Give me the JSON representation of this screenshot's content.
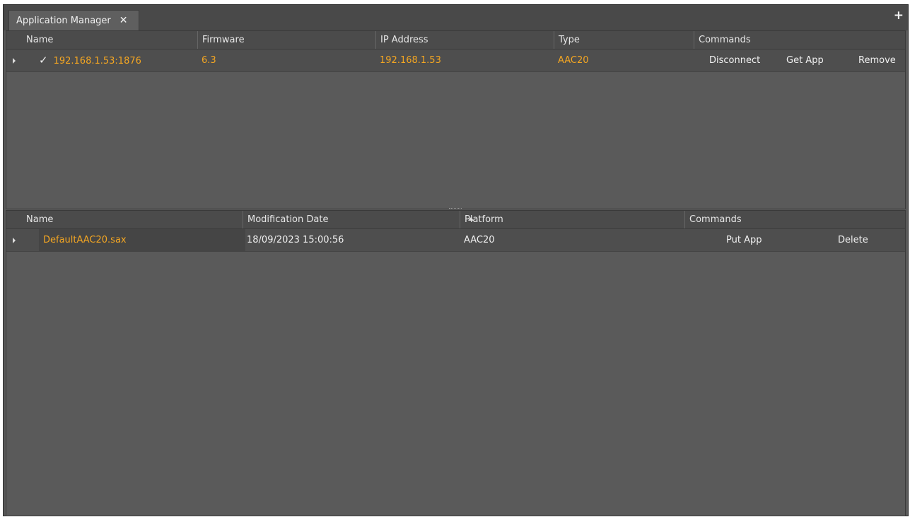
{
  "tab": {
    "title": "Application Manager",
    "close_icon": "close-icon",
    "add_icon": "plus-icon"
  },
  "devices": {
    "headers": [
      "Name",
      "Firmware",
      "IP Address",
      "Type",
      "Commands"
    ],
    "rows": [
      {
        "checked": true,
        "name": "192.168.1.53:1876",
        "firmware": "6.3",
        "ip": "192.168.1.53",
        "type": "AAC20",
        "commands": [
          "Disconnect",
          "Get App",
          "Remove"
        ]
      }
    ]
  },
  "apps": {
    "headers": [
      "Name",
      "Modification Date",
      "Platform",
      "Commands"
    ],
    "sort": {
      "column": "Modification Date",
      "direction": "ascending"
    },
    "rows": [
      {
        "name": "DefaultAAC20.sax",
        "date": "18/09/2023 15:00:56",
        "platform": "AAC20",
        "commands": [
          "Put App",
          "Delete"
        ]
      }
    ]
  },
  "colors": {
    "accent": "#f4a622",
    "background": "#5a5a5a",
    "header": "#4b4b4b"
  }
}
